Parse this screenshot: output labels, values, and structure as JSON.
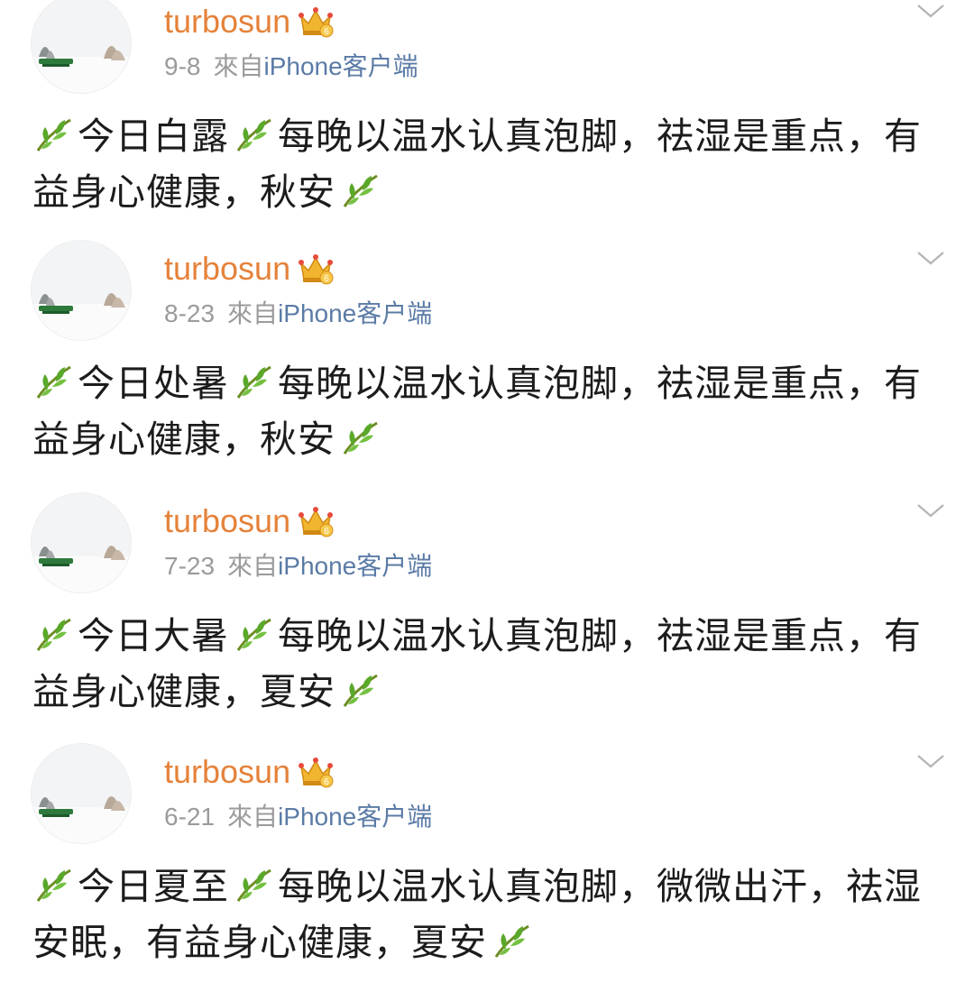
{
  "posts": [
    {
      "username": "turbosun",
      "date": "9-8",
      "from_label": "來自",
      "client": "iPhone客户端",
      "text": {
        "part1": "今日白露",
        "part2": "每晚以温水认真泡脚，祛湿是重点，有益身心健康，秋安"
      }
    },
    {
      "username": "turbosun",
      "date": "8-23",
      "from_label": "來自",
      "client": "iPhone客户端",
      "text": {
        "part1": "今日处暑",
        "part2": "每晚以温水认真泡脚，祛湿是重点，有益身心健康，秋安"
      }
    },
    {
      "username": "turbosun",
      "date": "7-23",
      "from_label": "來自",
      "client": "iPhone客户端",
      "text": {
        "part1": "今日大暑",
        "part2": "每晚以温水认真泡脚，祛湿是重点，有益身心健康，夏安"
      }
    },
    {
      "username": "turbosun",
      "date": "6-21",
      "from_label": "來自",
      "client": "iPhone客户端",
      "text": {
        "part1": "今日夏至",
        "part2": "每晚以温水认真泡脚，微微出汗，祛湿安眠，有益身心健康，夏安"
      }
    }
  ],
  "icons": {
    "leaf": "leaf-emoji-icon",
    "vip": "vip-crown-icon",
    "more": "chevron-down-icon"
  },
  "colors": {
    "username": "#e5823a",
    "client_link": "#5b7ba6",
    "meta": "#9b9b9b",
    "text": "#1c1c1c",
    "leaf": "#5aa82a"
  }
}
